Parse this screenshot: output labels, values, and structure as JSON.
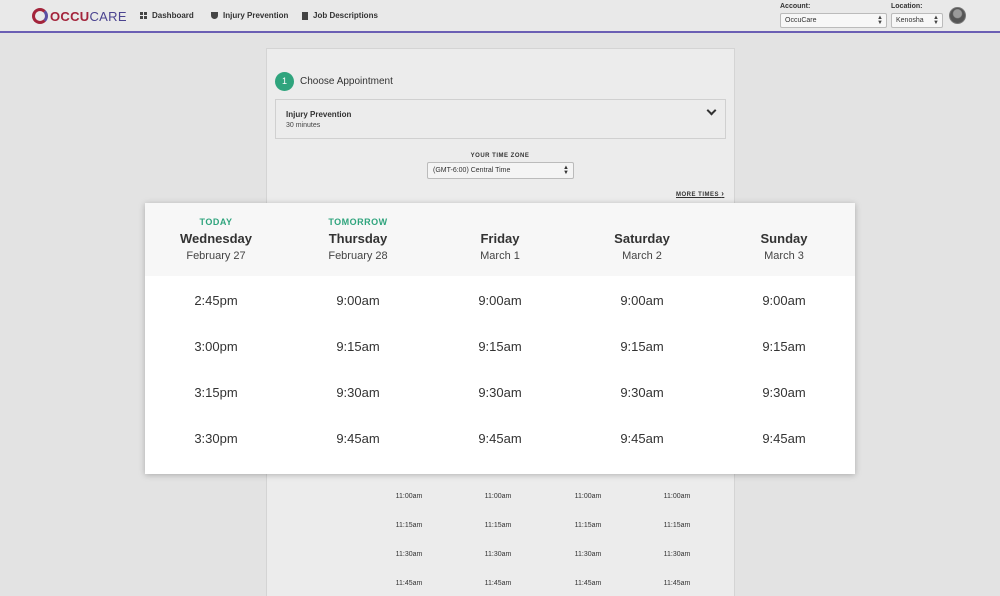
{
  "header": {
    "logo": {
      "prefix": "OCCU",
      "suffix": "CARE"
    },
    "nav": [
      {
        "label": "Dashboard",
        "icon": "dashboard-icon"
      },
      {
        "label": "Injury Prevention",
        "icon": "shield-icon"
      },
      {
        "label": "Job Descriptions",
        "icon": "document-icon"
      }
    ],
    "account": {
      "label": "Account:",
      "value": "OccuCare"
    },
    "location": {
      "label": "Location:",
      "value": "Kenosha"
    }
  },
  "step": {
    "number": "1",
    "title": "Choose Appointment"
  },
  "appointment": {
    "name": "Injury Prevention",
    "duration": "30 minutes"
  },
  "timezone": {
    "label": "YOUR TIME ZONE",
    "value": "(GMT-6:00) Central Time"
  },
  "more_times": "MORE TIMES",
  "days": [
    {
      "badge": "TODAY",
      "name": "Wednesday",
      "date": "February 27",
      "slots": [
        "2:45pm",
        "3:00pm",
        "3:15pm",
        "3:30pm"
      ]
    },
    {
      "badge": "TOMORROW",
      "name": "Thursday",
      "date": "February 28",
      "slots": [
        "9:00am",
        "9:15am",
        "9:30am",
        "9:45am"
      ]
    },
    {
      "badge": "",
      "name": "Friday",
      "date": "March 1",
      "slots": [
        "9:00am",
        "9:15am",
        "9:30am",
        "9:45am"
      ]
    },
    {
      "badge": "",
      "name": "Saturday",
      "date": "March 2",
      "slots": [
        "9:00am",
        "9:15am",
        "9:30am",
        "9:45am"
      ]
    },
    {
      "badge": "",
      "name": "Sunday",
      "date": "March 3",
      "slots": [
        "9:00am",
        "9:15am",
        "9:30am",
        "9:45am"
      ]
    }
  ],
  "background_slots": [
    [
      "11:00am",
      "11:00am",
      "11:00am",
      "11:00am"
    ],
    [
      "11:15am",
      "11:15am",
      "11:15am",
      "11:15am"
    ],
    [
      "11:30am",
      "11:30am",
      "11:30am",
      "11:30am"
    ],
    [
      "11:45am",
      "11:45am",
      "11:45am",
      "11:45am"
    ]
  ],
  "colors": {
    "accent": "#2fa47d",
    "nav_border": "#6b5fb4",
    "logo_red": "#a3243b"
  }
}
